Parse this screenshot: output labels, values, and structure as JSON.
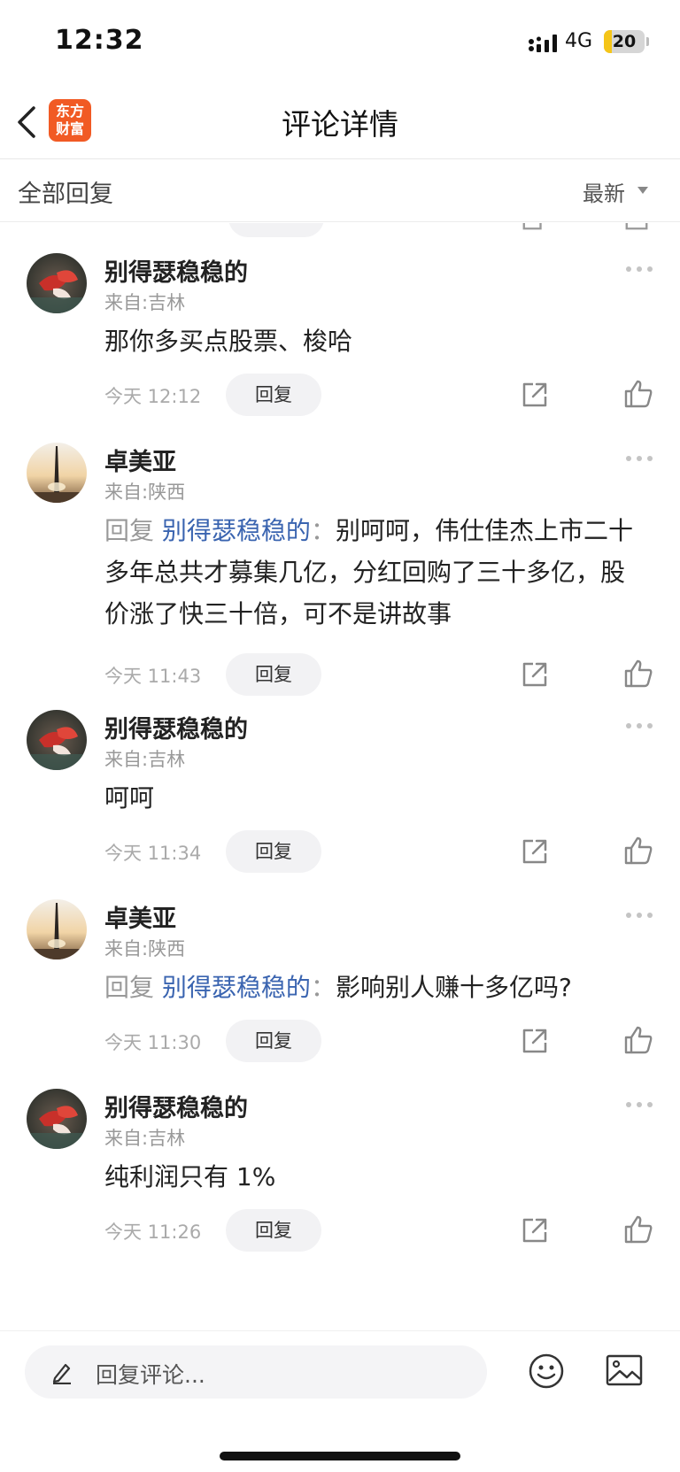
{
  "status_bar": {
    "time": "12:32",
    "network": "4G",
    "battery": "20",
    "battery_level": 0.2
  },
  "header": {
    "title": "评论详情",
    "logo_text": [
      "东方",
      "财富"
    ]
  },
  "section": {
    "title": "全部回复",
    "sort_label": "最新"
  },
  "comments": [
    {
      "user": "别得瑟稳稳的",
      "location": "来自:吉林",
      "text": "那你多买点股票、梭哈",
      "reply_to": null,
      "time": "今天 12:12",
      "reply_label": "回复",
      "avatar": "red-leaf"
    },
    {
      "user": "卓美亚",
      "location": "来自:陕西",
      "reply_prefix": "回复",
      "reply_to": "别得瑟稳稳的",
      "separator": "：",
      "text": "别呵呵，伟仕佳杰上市二十多年总共才募集几亿，分红回购了三十多亿，股价涨了快三十倍，可不是讲故事",
      "time": "今天 11:43",
      "reply_label": "回复",
      "avatar": "sunset-obelisk"
    },
    {
      "user": "别得瑟稳稳的",
      "location": "来自:吉林",
      "text": "呵呵",
      "reply_to": null,
      "time": "今天 11:34",
      "reply_label": "回复",
      "avatar": "red-leaf"
    },
    {
      "user": "卓美亚",
      "location": "来自:陕西",
      "reply_prefix": "回复",
      "reply_to": "别得瑟稳稳的",
      "separator": "：",
      "text": "影响别人赚十多亿吗?",
      "time": "今天 11:30",
      "reply_label": "回复",
      "avatar": "sunset-obelisk"
    },
    {
      "user": "别得瑟稳稳的",
      "location": "来自:吉林",
      "text": "纯利润只有 1%",
      "reply_to": null,
      "time": "今天 11:26",
      "reply_label": "回复",
      "avatar": "red-leaf"
    }
  ],
  "bottom_bar": {
    "placeholder": "回复评论..."
  },
  "colors": {
    "link": "#3a64b0",
    "logo": "#f15a24",
    "battery": "#f5c518"
  }
}
